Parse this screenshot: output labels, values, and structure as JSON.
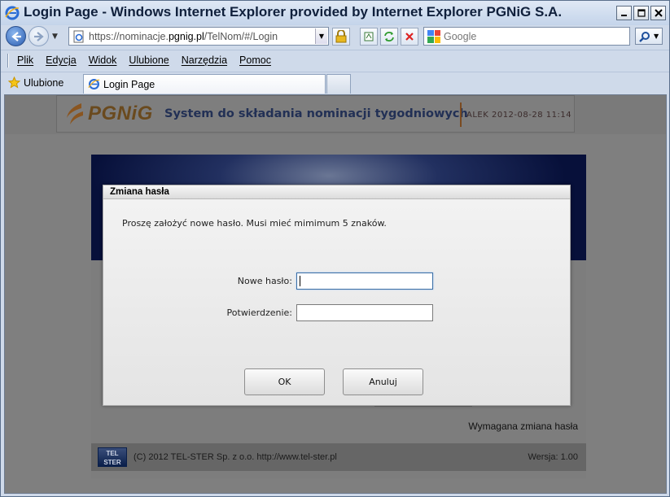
{
  "window": {
    "title": "Login Page - Windows Internet Explorer provided by Internet Explorer PGNiG S.A.",
    "controls": [
      "_",
      "□",
      "✕"
    ]
  },
  "address_bar": {
    "url_prefix": "https://nominacje.",
    "url_domain": "pgnig.pl",
    "url_path": "/TelNom/#/Login"
  },
  "search": {
    "placeholder": "Google"
  },
  "menu": [
    "Plik",
    "Edycja",
    "Widok",
    "Ulubione",
    "Narzędzia",
    "Pomoc"
  ],
  "favorites": {
    "label": "Ulubione"
  },
  "tab": {
    "title": "Login Page"
  },
  "page": {
    "logo_text": "PGNiG",
    "system_title": "System do składania nominacji tygodniowych",
    "user_info": "ALEK 2012-08-28 11:14",
    "status_text": "Wymagana zmiana hasła",
    "footer": {
      "logo_line1": "TEL",
      "logo_line2": "STER",
      "copyright": "(C) 2012 TEL-STER Sp. z o.o.   http://www.tel-ster.pl",
      "version": "Wersja: 1.00"
    }
  },
  "dialog": {
    "title": "Zmiana hasła",
    "message": "Proszę założyć nowe hasło. Musi mieć mimimum 5 znaków.",
    "new_password_label": "Nowe hasło:",
    "new_password_value": "",
    "confirm_label": "Potwierdzenie:",
    "confirm_value": "",
    "ok_label": "OK",
    "cancel_label": "Anuluj"
  },
  "colors": {
    "window_chrome": "#cfdaea",
    "overlay_gray": "#7f7f7f",
    "banner_navy": "#07103a",
    "dialog_bg": "#f0f0f0"
  }
}
